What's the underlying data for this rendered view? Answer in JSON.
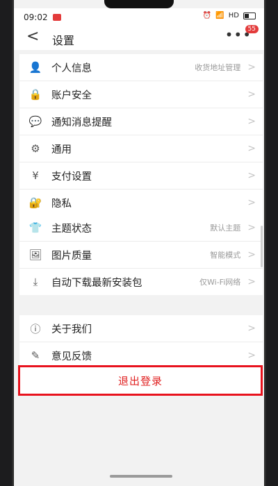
{
  "status": {
    "time": "09:02",
    "network": "HD"
  },
  "nav": {
    "back": "<",
    "title": "设置",
    "more": "•••",
    "badge": "55"
  },
  "group1": [
    {
      "name": "personal-info",
      "icon": "user-icon",
      "glyph": "👤",
      "label": "个人信息",
      "value": "收货地址管理"
    },
    {
      "name": "account-security",
      "icon": "lock-icon",
      "glyph": "🔒",
      "label": "账户安全",
      "value": ""
    },
    {
      "name": "notifications",
      "icon": "chat-bubble-icon",
      "glyph": "💬",
      "label": "通知消息提醒",
      "value": ""
    },
    {
      "name": "general",
      "icon": "gear-icon",
      "glyph": "⚙",
      "label": "通用",
      "value": ""
    },
    {
      "name": "payment",
      "icon": "yen-icon",
      "glyph": "¥",
      "label": "支付设置",
      "value": ""
    },
    {
      "name": "privacy",
      "icon": "privacy-lock-icon",
      "glyph": "🔐",
      "label": "隐私",
      "value": ""
    }
  ],
  "group2": [
    {
      "name": "theme",
      "icon": "tshirt-icon",
      "glyph": "👕",
      "label": "主题状态",
      "value": "默认主题"
    },
    {
      "name": "image-quality",
      "icon": "image-icon",
      "glyph": "🖼",
      "label": "图片质量",
      "value": "智能模式"
    },
    {
      "name": "auto-download",
      "icon": "download-icon",
      "glyph": "⤓",
      "label": "自动下载最新安装包",
      "value": "仅Wi-Fi网络"
    }
  ],
  "group3": [
    {
      "name": "about-us",
      "icon": "info-icon",
      "glyph": "ⓘ",
      "label": "关于我们",
      "value": ""
    },
    {
      "name": "feedback",
      "icon": "edit-icon",
      "glyph": "✎",
      "label": "意见反馈",
      "value": ""
    }
  ],
  "logout": {
    "label": "退出登录"
  },
  "colors": {
    "accent": "#e8121d",
    "background": "#f2f2f2"
  }
}
